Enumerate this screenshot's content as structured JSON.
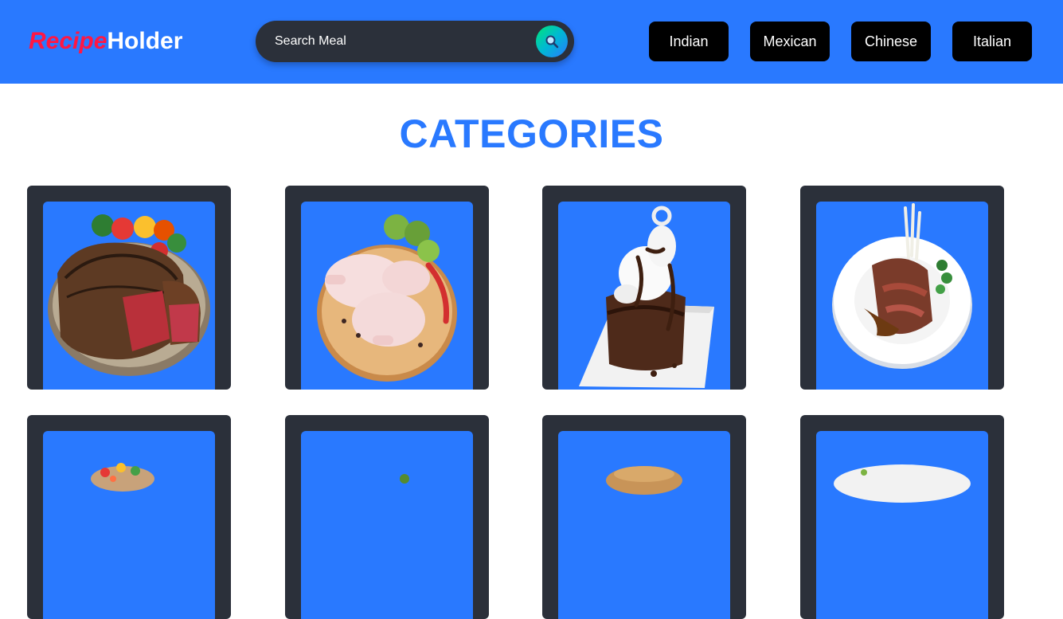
{
  "logo": {
    "part1": "Recipe",
    "part2": "Holder"
  },
  "search": {
    "placeholder": "Search Meal",
    "button_icon": "search-icon"
  },
  "nav": [
    {
      "label": "Indian"
    },
    {
      "label": "Mexican"
    },
    {
      "label": "Chinese"
    },
    {
      "label": "Italian"
    }
  ],
  "page_title": "CATEGORIES",
  "categories": [
    {
      "image": "grilled-beef-steak-image"
    },
    {
      "image": "raw-chicken-legs-image"
    },
    {
      "image": "chocolate-dessert-image"
    },
    {
      "image": "lamb-chops-plate-image"
    },
    {
      "image": "salad-bowl-image"
    },
    {
      "image": "vegetable-dish-image"
    },
    {
      "image": "pastry-dish-image"
    },
    {
      "image": "plated-dish-image"
    }
  ],
  "colors": {
    "header_bg": "#2979ff",
    "accent": "#2979ff",
    "logo_red": "#ff1744",
    "card_bg": "#2b303a",
    "button_bg": "#000000"
  }
}
